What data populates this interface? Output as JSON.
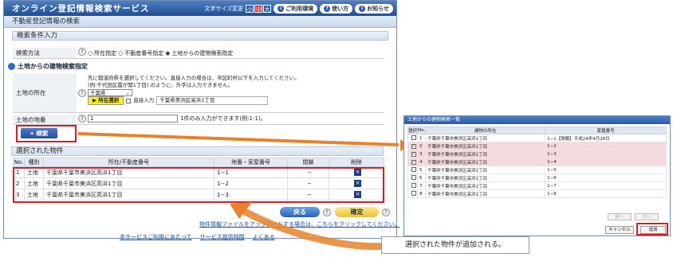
{
  "app": {
    "title": "オンライン登記情報検索サービス",
    "font_size_label": "文字サイズ変更",
    "font_small": "小",
    "font_medium": "中",
    "font_large": "大",
    "env_label": "ご利用環境",
    "help_label": "使い方",
    "news_label": "お知らせ"
  },
  "page": {
    "title": "不動産登記情報の検索"
  },
  "conditions": {
    "heading": "検索条件入力",
    "method_label": "検索方法",
    "method_opt1": "所在指定",
    "method_opt2": "不動産番号指定",
    "method_opt3": "土地からの建物検索指定"
  },
  "land": {
    "subheading": "土地からの建物検索指定",
    "location_label": "土地の所在",
    "instruction1": "先に都道府県を選択してください。直接入力の場合は、市区町村以下を入力してください。",
    "instruction2": "(例:千代田区霞が関1丁目) のように、外字は入力できません。",
    "prefecture": "千葉県",
    "select_btn": "所在選択",
    "direct_label": "直接入力",
    "address": "千葉県美浜区高浜1丁目",
    "lot_label": "土地の地番",
    "lot_value": "1",
    "lot_hint": "1件のみ入力ができます(例:1-1)。",
    "search_btn": "検索"
  },
  "selected": {
    "heading": "選択された物件",
    "columns": [
      "No.",
      "種別",
      "所在/不動産番号",
      "地番・家屋番号",
      "閉鎖",
      "削除"
    ],
    "rows": [
      {
        "no": "1",
        "type": "土地",
        "addr": "千葉県千葉市美浜区高浜1丁目",
        "lot": "1−1",
        "closed": "−"
      },
      {
        "no": "2",
        "type": "土地",
        "addr": "千葉県千葉市美浜区高浜1丁目",
        "lot": "1−2",
        "closed": "−"
      },
      {
        "no": "3",
        "type": "土地",
        "addr": "千葉県千葉市美浜区高浜1丁目",
        "lot": "1−3",
        "closed": "−"
      }
    ]
  },
  "footer": {
    "back_btn": "戻る",
    "confirm_btn": "確定",
    "note": "物件情報ファイルをアップロードする場合は、こちらをクリックしてください。",
    "link1": "本サービスご利用にあたって",
    "link2": "サービス提供時間",
    "link3": "よくある"
  },
  "dialog": {
    "title": "土地からの建物検索一覧",
    "columns": [
      "選択",
      "No.",
      "建物の所在",
      "家屋番号"
    ],
    "rows": [
      {
        "no": "1",
        "checked": false,
        "addr": "千葉県千葉市美浜区高浜1丁目",
        "house": "1−1【閉鎖】平成24年4月28日"
      },
      {
        "no": "2",
        "checked": true,
        "addr": "千葉県千葉市美浜区高浜1丁目",
        "house": "1−2"
      },
      {
        "no": "3",
        "checked": true,
        "addr": "千葉県千葉市美浜区高浜1丁目",
        "house": "1−3"
      },
      {
        "no": "4",
        "checked": true,
        "addr": "千葉県千葉市美浜区高浜1丁目",
        "house": "1−4"
      },
      {
        "no": "5",
        "checked": false,
        "addr": "千葉県千葉市美浜区高浜1丁目",
        "house": "1−5"
      },
      {
        "no": "6",
        "checked": false,
        "addr": "千葉県千葉市美浜区高浜1丁目",
        "house": "1−6"
      },
      {
        "no": "7",
        "checked": false,
        "addr": "千葉県千葉市美浜区高浜1丁目",
        "house": "1−7"
      },
      {
        "no": "8",
        "checked": false,
        "addr": "千葉県千葉市美浜区高浜1丁目",
        "house": "1−8"
      }
    ],
    "prev_btn": "前へ",
    "next_btn": "次へ",
    "cancel_btn": "キャンセル",
    "add_btn": "追加"
  },
  "caption": "選択された物件が追加される。",
  "colors": {
    "accent": "#1f4e95",
    "highlight": "#e3191d",
    "arrow": "#e8822a"
  }
}
